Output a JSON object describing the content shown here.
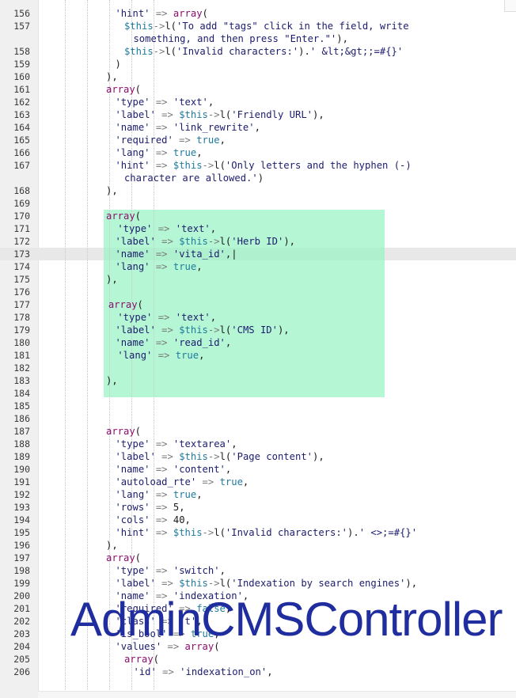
{
  "watermark": "AdminCMSController",
  "colors": {
    "highlight": "#98f2c4",
    "string": "#1c1c6e",
    "variable": "#1f7a9e",
    "keyword": "#8a0f6b",
    "operator": "#7a7a7a",
    "watermark": "#1f2d9e"
  },
  "lines": [
    {
      "n": "156",
      "indent": 6,
      "segs": [
        [
          "str",
          "'hint'"
        ],
        [
          "op",
          " => "
        ],
        [
          "kw",
          "array"
        ],
        [
          "plain",
          "("
        ]
      ]
    },
    {
      "n": "157",
      "indent": 8,
      "segs": [
        [
          "var",
          "$this"
        ],
        [
          "op",
          "->"
        ],
        [
          "plain",
          "l("
        ],
        [
          "str",
          "'To add \"tags\" click in the field, write"
        ]
      ]
    },
    {
      "n": "",
      "indent": 10,
      "segs": [
        [
          "str",
          "something, and then press \"Enter.\"'"
        ],
        [
          "plain",
          "),"
        ]
      ]
    },
    {
      "n": "158",
      "indent": 8,
      "segs": [
        [
          "var",
          "$this"
        ],
        [
          "op",
          "->"
        ],
        [
          "plain",
          "l("
        ],
        [
          "str",
          "'Invalid characters:'"
        ],
        [
          "plain",
          ")."
        ],
        [
          "str",
          "' &lt;&gt;;=#{}'"
        ]
      ]
    },
    {
      "n": "159",
      "indent": 6,
      "segs": [
        [
          "plain",
          ")"
        ]
      ]
    },
    {
      "n": "160",
      "indent": 4,
      "segs": [
        [
          "plain",
          "),"
        ]
      ]
    },
    {
      "n": "161",
      "indent": 4,
      "segs": [
        [
          "kw",
          "array"
        ],
        [
          "plain",
          "("
        ]
      ]
    },
    {
      "n": "162",
      "indent": 6,
      "segs": [
        [
          "str",
          "'type'"
        ],
        [
          "op",
          " => "
        ],
        [
          "str",
          "'text'"
        ],
        [
          "plain",
          ","
        ]
      ]
    },
    {
      "n": "163",
      "indent": 6,
      "segs": [
        [
          "str",
          "'label'"
        ],
        [
          "op",
          " => "
        ],
        [
          "var",
          "$this"
        ],
        [
          "op",
          "->"
        ],
        [
          "plain",
          "l("
        ],
        [
          "str",
          "'Friendly URL'"
        ],
        [
          "plain",
          "),"
        ]
      ]
    },
    {
      "n": "164",
      "indent": 6,
      "segs": [
        [
          "str",
          "'name'"
        ],
        [
          "op",
          " => "
        ],
        [
          "str",
          "'link_rewrite'"
        ],
        [
          "plain",
          ","
        ]
      ]
    },
    {
      "n": "165",
      "indent": 6,
      "segs": [
        [
          "str",
          "'required'"
        ],
        [
          "op",
          " => "
        ],
        [
          "var",
          "true"
        ],
        [
          "plain",
          ","
        ]
      ]
    },
    {
      "n": "166",
      "indent": 6,
      "segs": [
        [
          "str",
          "'lang'"
        ],
        [
          "op",
          " => "
        ],
        [
          "var",
          "true"
        ],
        [
          "plain",
          ","
        ]
      ]
    },
    {
      "n": "167",
      "indent": 6,
      "segs": [
        [
          "str",
          "'hint'"
        ],
        [
          "op",
          " => "
        ],
        [
          "var",
          "$this"
        ],
        [
          "op",
          "->"
        ],
        [
          "plain",
          "l("
        ],
        [
          "str",
          "'Only letters and the hyphen (-)"
        ]
      ]
    },
    {
      "n": "",
      "indent": 8,
      "segs": [
        [
          "str",
          "character are allowed.'"
        ],
        [
          "plain",
          ")"
        ]
      ]
    },
    {
      "n": "168",
      "indent": 4,
      "segs": [
        [
          "plain",
          "),"
        ]
      ]
    },
    {
      "n": "169",
      "indent": 0,
      "segs": []
    },
    {
      "n": "170",
      "indent": 4,
      "segs": [
        [
          "kw",
          "array"
        ],
        [
          "plain",
          "("
        ]
      ]
    },
    {
      "n": "171",
      "indent": 6.5,
      "segs": [
        [
          "str",
          "'type'"
        ],
        [
          "op",
          " => "
        ],
        [
          "str",
          "'text'"
        ],
        [
          "plain",
          ","
        ]
      ]
    },
    {
      "n": "172",
      "indent": 6,
      "segs": [
        [
          "str",
          "'label'"
        ],
        [
          "op",
          " => "
        ],
        [
          "var",
          "$this"
        ],
        [
          "op",
          "->"
        ],
        [
          "plain",
          "l("
        ],
        [
          "str",
          "'Herb ID'"
        ],
        [
          "plain",
          "),"
        ]
      ]
    },
    {
      "n": "173",
      "indent": 6,
      "current": true,
      "segs": [
        [
          "str",
          "'name'"
        ],
        [
          "op",
          " => "
        ],
        [
          "str",
          "'vita_id'"
        ],
        [
          "plain",
          ",|"
        ]
      ]
    },
    {
      "n": "174",
      "indent": 6,
      "segs": [
        [
          "str",
          "'lang'"
        ],
        [
          "op",
          " => "
        ],
        [
          "var",
          "true"
        ],
        [
          "plain",
          ","
        ]
      ]
    },
    {
      "n": "175",
      "indent": 4,
      "segs": [
        [
          "plain",
          "),"
        ]
      ]
    },
    {
      "n": "176",
      "indent": 0,
      "segs": []
    },
    {
      "n": "177",
      "indent": 4.5,
      "segs": [
        [
          "kw",
          "array"
        ],
        [
          "plain",
          "("
        ]
      ]
    },
    {
      "n": "178",
      "indent": 6.5,
      "segs": [
        [
          "str",
          "'type'"
        ],
        [
          "op",
          " => "
        ],
        [
          "str",
          "'text'"
        ],
        [
          "plain",
          ","
        ]
      ]
    },
    {
      "n": "179",
      "indent": 6,
      "segs": [
        [
          "str",
          "'label'"
        ],
        [
          "op",
          " => "
        ],
        [
          "var",
          "$this"
        ],
        [
          "op",
          "->"
        ],
        [
          "plain",
          "l("
        ],
        [
          "str",
          "'CMS ID'"
        ],
        [
          "plain",
          "),"
        ]
      ]
    },
    {
      "n": "180",
      "indent": 6,
      "segs": [
        [
          "str",
          "'name'"
        ],
        [
          "op",
          " => "
        ],
        [
          "str",
          "'read_id'"
        ],
        [
          "plain",
          ","
        ]
      ]
    },
    {
      "n": "181",
      "indent": 6.5,
      "segs": [
        [
          "str",
          "'lang'"
        ],
        [
          "op",
          " => "
        ],
        [
          "var",
          "true"
        ],
        [
          "plain",
          ","
        ]
      ]
    },
    {
      "n": "182",
      "indent": 0,
      "segs": []
    },
    {
      "n": "183",
      "indent": 4,
      "segs": [
        [
          "plain",
          "),"
        ]
      ]
    },
    {
      "n": "184",
      "indent": 0,
      "segs": []
    },
    {
      "n": "185",
      "indent": 0,
      "segs": []
    },
    {
      "n": "186",
      "indent": 0,
      "segs": []
    },
    {
      "n": "187",
      "indent": 4,
      "segs": [
        [
          "kw",
          "array"
        ],
        [
          "plain",
          "("
        ]
      ]
    },
    {
      "n": "188",
      "indent": 6,
      "segs": [
        [
          "str",
          "'type'"
        ],
        [
          "op",
          " => "
        ],
        [
          "str",
          "'textarea'"
        ],
        [
          "plain",
          ","
        ]
      ]
    },
    {
      "n": "189",
      "indent": 6,
      "segs": [
        [
          "str",
          "'label'"
        ],
        [
          "op",
          " => "
        ],
        [
          "var",
          "$this"
        ],
        [
          "op",
          "->"
        ],
        [
          "plain",
          "l("
        ],
        [
          "str",
          "'Page content'"
        ],
        [
          "plain",
          "),"
        ]
      ]
    },
    {
      "n": "190",
      "indent": 6,
      "segs": [
        [
          "str",
          "'name'"
        ],
        [
          "op",
          " => "
        ],
        [
          "str",
          "'content'"
        ],
        [
          "plain",
          ","
        ]
      ]
    },
    {
      "n": "191",
      "indent": 6,
      "segs": [
        [
          "str",
          "'autoload_rte'"
        ],
        [
          "op",
          " => "
        ],
        [
          "var",
          "true"
        ],
        [
          "plain",
          ","
        ]
      ]
    },
    {
      "n": "192",
      "indent": 6,
      "segs": [
        [
          "str",
          "'lang'"
        ],
        [
          "op",
          " => "
        ],
        [
          "var",
          "true"
        ],
        [
          "plain",
          ","
        ]
      ]
    },
    {
      "n": "193",
      "indent": 6,
      "segs": [
        [
          "str",
          "'rows'"
        ],
        [
          "op",
          " => "
        ],
        [
          "plain",
          "5,"
        ]
      ]
    },
    {
      "n": "194",
      "indent": 6,
      "segs": [
        [
          "str",
          "'cols'"
        ],
        [
          "op",
          " => "
        ],
        [
          "plain",
          "40,"
        ]
      ]
    },
    {
      "n": "195",
      "indent": 6,
      "segs": [
        [
          "str",
          "'hint'"
        ],
        [
          "op",
          " => "
        ],
        [
          "var",
          "$this"
        ],
        [
          "op",
          "->"
        ],
        [
          "plain",
          "l("
        ],
        [
          "str",
          "'Invalid characters:'"
        ],
        [
          "plain",
          ")."
        ],
        [
          "str",
          "' <>;=#{}'"
        ]
      ]
    },
    {
      "n": "196",
      "indent": 4,
      "segs": [
        [
          "plain",
          "),"
        ]
      ]
    },
    {
      "n": "197",
      "indent": 4,
      "segs": [
        [
          "kw",
          "array"
        ],
        [
          "plain",
          "("
        ]
      ]
    },
    {
      "n": "198",
      "indent": 6,
      "segs": [
        [
          "str",
          "'type'"
        ],
        [
          "op",
          " => "
        ],
        [
          "str",
          "'switch'"
        ],
        [
          "plain",
          ","
        ]
      ]
    },
    {
      "n": "199",
      "indent": 6,
      "segs": [
        [
          "str",
          "'label'"
        ],
        [
          "op",
          " => "
        ],
        [
          "var",
          "$this"
        ],
        [
          "op",
          "->"
        ],
        [
          "plain",
          "l("
        ],
        [
          "str",
          "'Indexation by search engines'"
        ],
        [
          "plain",
          "),"
        ]
      ]
    },
    {
      "n": "200",
      "indent": 6,
      "segs": [
        [
          "str",
          "'name'"
        ],
        [
          "op",
          " => "
        ],
        [
          "str",
          "'indexation'"
        ],
        [
          "plain",
          ","
        ]
      ]
    },
    {
      "n": "201",
      "indent": 6,
      "segs": [
        [
          "str",
          "'required'"
        ],
        [
          "op",
          " => "
        ],
        [
          "var",
          "false"
        ],
        [
          "plain",
          ","
        ]
      ]
    },
    {
      "n": "202",
      "indent": 6,
      "segs": [
        [
          "str",
          "'class'"
        ],
        [
          "op",
          " => "
        ],
        [
          "str",
          "'t'"
        ],
        [
          "plain",
          ","
        ]
      ]
    },
    {
      "n": "203",
      "indent": 6,
      "segs": [
        [
          "str",
          "'is_bool'"
        ],
        [
          "op",
          " => "
        ],
        [
          "var",
          "true"
        ],
        [
          "plain",
          ","
        ]
      ]
    },
    {
      "n": "204",
      "indent": 6,
      "segs": [
        [
          "str",
          "'values'"
        ],
        [
          "op",
          " => "
        ],
        [
          "kw",
          "array"
        ],
        [
          "plain",
          "("
        ]
      ]
    },
    {
      "n": "205",
      "indent": 8,
      "segs": [
        [
          "kw",
          "array"
        ],
        [
          "plain",
          "("
        ]
      ]
    },
    {
      "n": "206",
      "indent": 10,
      "segs": [
        [
          "str",
          "'id'"
        ],
        [
          "op",
          " => "
        ],
        [
          "str",
          "'indexation_on'"
        ],
        [
          "plain",
          ","
        ]
      ]
    }
  ]
}
